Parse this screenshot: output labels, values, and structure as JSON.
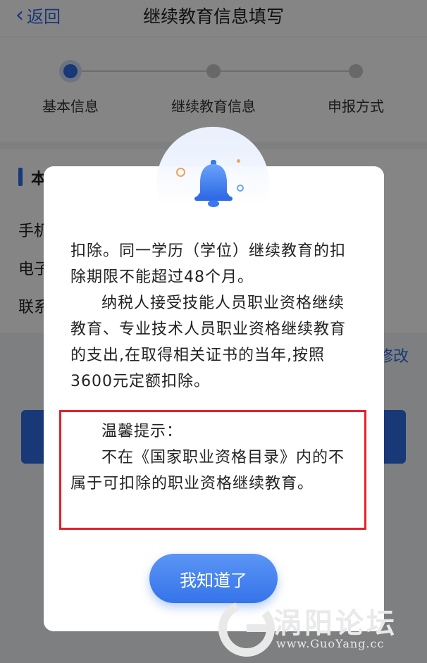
{
  "nav": {
    "back_label": "返回",
    "title": "继续教育信息填写"
  },
  "steps": [
    {
      "label": "基本信息",
      "active": true
    },
    {
      "label": "继续教育信息",
      "active": false
    },
    {
      "label": "申报方式",
      "active": false
    }
  ],
  "section": {
    "title": "本",
    "rows": [
      "手机",
      "电子",
      "联系"
    ],
    "edit_label": "修改"
  },
  "modal": {
    "paragraphs": [
      {
        "text": "扣除。同一学历（学位）继续教育的扣除期限不能超过48个月。",
        "indent": false
      },
      {
        "text": "纳税人接受技能人员职业资格继续教育、专业技术人员职业资格继续教育的支出,在取得相关证书的当年,按照3600元定额扣除。",
        "indent": true
      }
    ],
    "tip": {
      "heading": "温馨提示：",
      "body": "不在《国家职业资格目录》内的不属于可扣除的职业资格继续教育。"
    },
    "ok_label": "我知道了"
  },
  "watermark": {
    "name": "涡阳论坛",
    "url": "www.GuoYang.cc"
  },
  "colors": {
    "accent": "#2f6be5",
    "tip_border": "#e4202a"
  }
}
